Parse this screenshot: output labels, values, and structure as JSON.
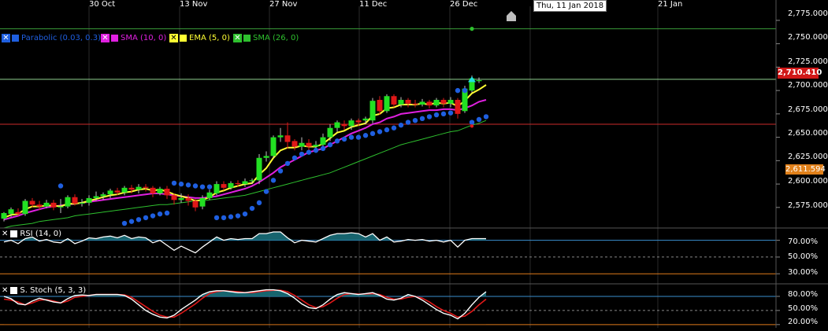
{
  "chart_data": {
    "type": "candlestick",
    "date_labels": [
      "30 Oct",
      "13 Nov",
      "27 Nov",
      "11 Dec",
      "26 Dec",
      "21 Jan"
    ],
    "crosshair_date": "Thu, 11 Jan 2018",
    "last_price_label": "2,710.410",
    "sma_price_label": "2,611.594",
    "price_ticks": [
      "2,775.000",
      "2,750.000",
      "2,725.000",
      "2,700.000",
      "2,675.000",
      "2,650.000",
      "2,625.000",
      "2,600.000",
      "2,575.000"
    ],
    "price_levels": [
      2775,
      2750,
      2725,
      2700,
      2675,
      2650,
      2625,
      2600,
      2575
    ],
    "ylim": [
      2553,
      2785
    ],
    "hlines": [
      {
        "price": 2766,
        "color": "#3a9a3a"
      },
      {
        "price": 2712,
        "color": "#8fd18f"
      },
      {
        "price": 2664,
        "color": "#cc2a2a"
      }
    ],
    "candles": [
      [
        2563,
        2569,
        2560,
        2570
      ],
      [
        2568,
        2573,
        2565,
        2575
      ],
      [
        2570,
        2568,
        2566,
        2574
      ],
      [
        2568,
        2582,
        2566,
        2584
      ],
      [
        2582,
        2578,
        2575,
        2585
      ],
      [
        2578,
        2576,
        2572,
        2582
      ],
      [
        2576,
        2580,
        2574,
        2583
      ],
      [
        2580,
        2575,
        2572,
        2583
      ],
      [
        2575,
        2576,
        2569,
        2584
      ],
      [
        2576,
        2586,
        2574,
        2588
      ],
      [
        2586,
        2579,
        2577,
        2589
      ],
      [
        2579,
        2580,
        2576,
        2584
      ],
      [
        2580,
        2585,
        2577,
        2588
      ],
      [
        2585,
        2587,
        2582,
        2592
      ],
      [
        2587,
        2589,
        2583,
        2591
      ],
      [
        2589,
        2593,
        2585,
        2595
      ],
      [
        2593,
        2591,
        2588,
        2596
      ],
      [
        2591,
        2596,
        2588,
        2598
      ],
      [
        2596,
        2594,
        2590,
        2599
      ],
      [
        2594,
        2597,
        2590,
        2600
      ],
      [
        2597,
        2596,
        2592,
        2600
      ],
      [
        2596,
        2590,
        2586,
        2598
      ],
      [
        2590,
        2595,
        2588,
        2597
      ],
      [
        2595,
        2588,
        2584,
        2598
      ],
      [
        2588,
        2583,
        2578,
        2590
      ],
      [
        2583,
        2585,
        2580,
        2590
      ],
      [
        2585,
        2582,
        2577,
        2589
      ],
      [
        2582,
        2575,
        2571,
        2584
      ],
      [
        2576,
        2585,
        2573,
        2588
      ],
      [
        2585,
        2591,
        2583,
        2594
      ],
      [
        2590,
        2600,
        2588,
        2603
      ],
      [
        2600,
        2596,
        2593,
        2603
      ],
      [
        2596,
        2601,
        2594,
        2603
      ],
      [
        2601,
        2600,
        2597,
        2604
      ],
      [
        2600,
        2603,
        2597,
        2606
      ],
      [
        2603,
        2604,
        2600,
        2606
      ],
      [
        2604,
        2628,
        2600,
        2632
      ],
      [
        2628,
        2630,
        2624,
        2635
      ],
      [
        2630,
        2650,
        2628,
        2652
      ],
      [
        2650,
        2652,
        2645,
        2660
      ],
      [
        2652,
        2645,
        2638,
        2666
      ],
      [
        2646,
        2640,
        2636,
        2648
      ],
      [
        2640,
        2644,
        2636,
        2650
      ],
      [
        2644,
        2640,
        2636,
        2648
      ],
      [
        2640,
        2642,
        2636,
        2646
      ],
      [
        2642,
        2650,
        2638,
        2654
      ],
      [
        2650,
        2660,
        2646,
        2664
      ],
      [
        2660,
        2666,
        2656,
        2668
      ],
      [
        2664,
        2662,
        2658,
        2668
      ],
      [
        2662,
        2668,
        2658,
        2670
      ],
      [
        2668,
        2666,
        2662,
        2670
      ],
      [
        2668,
        2670,
        2664,
        2672
      ],
      [
        2668,
        2689,
        2665,
        2692
      ],
      [
        2690,
        2678,
        2674,
        2694
      ],
      [
        2678,
        2694,
        2676,
        2696
      ],
      [
        2694,
        2685,
        2682,
        2696
      ],
      [
        2685,
        2690,
        2682,
        2693
      ],
      [
        2690,
        2686,
        2682,
        2692
      ],
      [
        2686,
        2685,
        2682,
        2690
      ],
      [
        2685,
        2688,
        2683,
        2691
      ],
      [
        2688,
        2684,
        2681,
        2690
      ],
      [
        2684,
        2690,
        2682,
        2692
      ],
      [
        2690,
        2686,
        2682,
        2692
      ],
      [
        2686,
        2690,
        2682,
        2693
      ],
      [
        2690,
        2675,
        2670,
        2692
      ],
      [
        2678,
        2702,
        2676,
        2705
      ],
      [
        2700,
        2713,
        2698,
        2716
      ],
      [
        2710,
        2711,
        2708,
        2714
      ]
    ],
    "parabolic_sar": [
      {
        "i": 8,
        "v": 2598
      },
      {
        "i": 17,
        "v": 2558
      },
      {
        "i": 18,
        "v": 2560
      },
      {
        "i": 19,
        "v": 2562
      },
      {
        "i": 20,
        "v": 2564
      },
      {
        "i": 21,
        "v": 2566
      },
      {
        "i": 22,
        "v": 2568
      },
      {
        "i": 23,
        "v": 2569
      },
      {
        "i": 24,
        "v": 2601
      },
      {
        "i": 25,
        "v": 2600
      },
      {
        "i": 26,
        "v": 2599
      },
      {
        "i": 27,
        "v": 2598
      },
      {
        "i": 28,
        "v": 2597
      },
      {
        "i": 29,
        "v": 2597
      },
      {
        "i": 30,
        "v": 2564
      },
      {
        "i": 31,
        "v": 2564
      },
      {
        "i": 32,
        "v": 2565
      },
      {
        "i": 33,
        "v": 2566
      },
      {
        "i": 34,
        "v": 2568
      },
      {
        "i": 35,
        "v": 2574
      },
      {
        "i": 36,
        "v": 2580
      },
      {
        "i": 37,
        "v": 2592
      },
      {
        "i": 38,
        "v": 2604
      },
      {
        "i": 39,
        "v": 2614
      },
      {
        "i": 40,
        "v": 2622
      },
      {
        "i": 41,
        "v": 2628
      },
      {
        "i": 42,
        "v": 2632
      },
      {
        "i": 43,
        "v": 2634
      },
      {
        "i": 44,
        "v": 2636
      },
      {
        "i": 45,
        "v": 2638
      },
      {
        "i": 46,
        "v": 2642
      },
      {
        "i": 47,
        "v": 2646
      },
      {
        "i": 48,
        "v": 2648
      },
      {
        "i": 49,
        "v": 2650
      },
      {
        "i": 50,
        "v": 2650
      },
      {
        "i": 51,
        "v": 2652
      },
      {
        "i": 52,
        "v": 2654
      },
      {
        "i": 53,
        "v": 2656
      },
      {
        "i": 54,
        "v": 2658
      },
      {
        "i": 55,
        "v": 2660
      },
      {
        "i": 56,
        "v": 2663
      },
      {
        "i": 57,
        "v": 2666
      },
      {
        "i": 58,
        "v": 2668
      },
      {
        "i": 59,
        "v": 2670
      },
      {
        "i": 60,
        "v": 2672
      },
      {
        "i": 61,
        "v": 2674
      },
      {
        "i": 62,
        "v": 2675
      },
      {
        "i": 63,
        "v": 2676
      },
      {
        "i": 64,
        "v": 2700
      },
      {
        "i": 65,
        "v": 2700
      },
      {
        "i": 66,
        "v": 2666
      },
      {
        "i": 67,
        "v": 2669
      },
      {
        "i": 68,
        "v": 2672
      }
    ],
    "sma10": [
      2562,
      2564,
      2566,
      2569,
      2571,
      2573,
      2575,
      2576,
      2577,
      2578,
      2579,
      2580,
      2581,
      2582,
      2583,
      2584,
      2585,
      2586,
      2587,
      2588,
      2589,
      2590,
      2590,
      2589,
      2588,
      2587,
      2586,
      2585,
      2585,
      2586,
      2587,
      2589,
      2591,
      2593,
      2595,
      2598,
      2602,
      2607,
      2612,
      2618,
      2622,
      2626,
      2630,
      2634,
      2636,
      2638,
      2642,
      2646,
      2650,
      2654,
      2657,
      2660,
      2664,
      2666,
      2670,
      2672,
      2675,
      2676,
      2677,
      2678,
      2679,
      2679,
      2680,
      2680,
      2679,
      2681,
      2684,
      2688,
      2690
    ],
    "ema5": [
      2564,
      2567,
      2568,
      2573,
      2576,
      2576,
      2577,
      2577,
      2576,
      2579,
      2579,
      2580,
      2582,
      2584,
      2586,
      2588,
      2589,
      2591,
      2592,
      2594,
      2595,
      2593,
      2594,
      2592,
      2589,
      2587,
      2585,
      2582,
      2583,
      2586,
      2591,
      2593,
      2596,
      2598,
      2600,
      2601,
      2610,
      2617,
      2628,
      2636,
      2639,
      2639,
      2641,
      2640,
      2640,
      2643,
      2649,
      2655,
      2657,
      2661,
      2663,
      2665,
      2673,
      2675,
      2681,
      2682,
      2685,
      2685,
      2685,
      2686,
      2685,
      2687,
      2686,
      2687,
      2683,
      2689,
      2697,
      2701,
      2706
    ],
    "sma26": [
      2553,
      2555,
      2556,
      2557,
      2558,
      2560,
      2561,
      2562,
      2563,
      2564,
      2566,
      2567,
      2568,
      2569,
      2570,
      2571,
      2572,
      2573,
      2574,
      2575,
      2576,
      2577,
      2578,
      2578,
      2579,
      2580,
      2581,
      2582,
      2582,
      2583,
      2584,
      2585,
      2586,
      2587,
      2588,
      2590,
      2592,
      2594,
      2596,
      2598,
      2600,
      2602,
      2604,
      2606,
      2608,
      2610,
      2612,
      2615,
      2618,
      2621,
      2624,
      2627,
      2630,
      2633,
      2636,
      2639,
      2642,
      2644,
      2646,
      2648,
      2650,
      2652,
      2654,
      2656,
      2657,
      2660,
      2663,
      2665,
      2668
    ],
    "series": [
      {
        "name": "Parabolic (0.03, 0.3)",
        "color": "#1f5fe0"
      },
      {
        "name": "SMA (10, 0)",
        "color": "#e020e0"
      },
      {
        "name": "EMA (5, 0)",
        "color": "#ffff33"
      },
      {
        "name": "SMA (26, 0)",
        "color": "#2ec02e"
      }
    ],
    "rsi": {
      "title": "RSI (14, 0)",
      "ticks": [
        "70.00%",
        "50.00%",
        "30.00%"
      ],
      "levels": [
        70,
        50,
        30
      ],
      "ylim": [
        18,
        80
      ],
      "values": [
        68,
        70,
        66,
        72,
        74,
        69,
        71,
        68,
        67,
        72,
        66,
        69,
        73,
        72,
        74,
        75,
        73,
        76,
        72,
        74,
        73,
        67,
        70,
        64,
        58,
        63,
        59,
        55,
        62,
        68,
        74,
        70,
        72,
        71,
        72,
        72,
        78,
        78,
        80,
        80,
        73,
        67,
        70,
        69,
        68,
        72,
        76,
        78,
        78,
        79,
        78,
        74,
        78,
        70,
        74,
        68,
        69,
        71,
        70,
        71,
        69,
        70,
        68,
        70,
        62,
        70,
        72,
        72,
        72
      ]
    },
    "stoch": {
      "title": "S. Stoch (5, 3, 3)",
      "ticks": [
        "80.00%",
        "50.00%",
        "20.00%"
      ],
      "levels": [
        80,
        50,
        20
      ],
      "ylim": [
        13,
        100
      ],
      "k": [
        80,
        75,
        64,
        62,
        70,
        76,
        72,
        68,
        66,
        75,
        82,
        83,
        82,
        84,
        84,
        84,
        84,
        82,
        74,
        62,
        50,
        42,
        36,
        34,
        40,
        52,
        62,
        72,
        84,
        90,
        92,
        92,
        90,
        88,
        88,
        90,
        92,
        94,
        94,
        92,
        86,
        76,
        64,
        56,
        54,
        62,
        74,
        84,
        88,
        86,
        84,
        86,
        88,
        82,
        74,
        72,
        76,
        84,
        80,
        72,
        62,
        52,
        44,
        40,
        32,
        44,
        62,
        78,
        90
      ],
      "d": [
        74,
        72,
        68,
        62,
        66,
        72,
        73,
        70,
        66,
        70,
        78,
        80,
        82,
        84,
        84,
        84,
        84,
        83,
        78,
        68,
        58,
        48,
        40,
        36,
        36,
        44,
        54,
        64,
        76,
        86,
        90,
        92,
        91,
        90,
        88,
        88,
        90,
        92,
        93,
        93,
        90,
        82,
        72,
        62,
        56,
        58,
        66,
        76,
        84,
        86,
        85,
        85,
        86,
        84,
        78,
        74,
        74,
        78,
        80,
        76,
        68,
        58,
        50,
        44,
        36,
        38,
        48,
        62,
        74
      ]
    }
  }
}
